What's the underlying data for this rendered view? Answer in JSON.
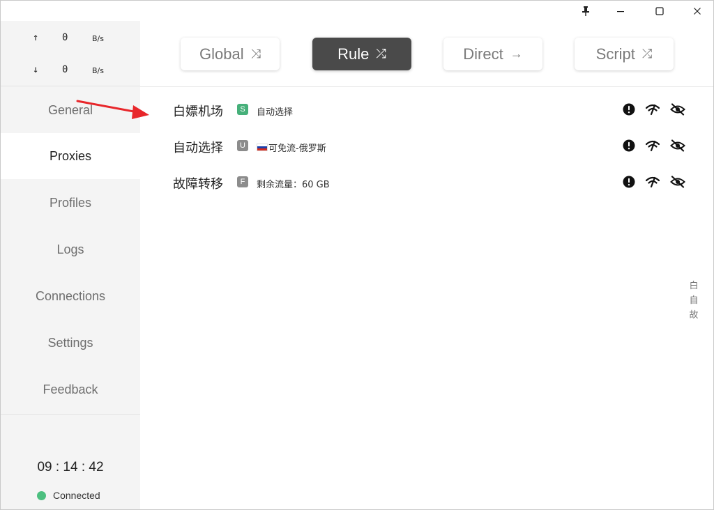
{
  "titlebar": {
    "pin_icon": "pin-icon",
    "minimize_icon": "minimize-icon",
    "maximize_icon": "maximize-icon",
    "close_icon": "close-icon"
  },
  "traffic": {
    "up_arrow": "↑",
    "up_value": "0",
    "up_unit": "B/s",
    "down_arrow": "↓",
    "down_value": "0",
    "down_unit": "B/s"
  },
  "nav": {
    "items": [
      {
        "label": "General"
      },
      {
        "label": "Proxies"
      },
      {
        "label": "Profiles"
      },
      {
        "label": "Logs"
      },
      {
        "label": "Connections"
      },
      {
        "label": "Settings"
      },
      {
        "label": "Feedback"
      }
    ],
    "active": "Proxies"
  },
  "status": {
    "clock": "09 : 14 : 42",
    "connection": "Connected",
    "connection_color": "#4cbf7f"
  },
  "modes": {
    "global_label": "Global",
    "global_glyph": "⤨",
    "rule_label": "Rule",
    "rule_glyph": "⤮",
    "direct_label": "Direct",
    "direct_glyph": "→",
    "script_label": "Script",
    "script_glyph": "⤮",
    "active": "Rule"
  },
  "groups": [
    {
      "name": "白嫖机场",
      "badge": "S",
      "badge_color": "#46b07a",
      "now": "自动选择"
    },
    {
      "name": "自动选择",
      "badge": "U",
      "badge_color": "#8c8c8c",
      "now": "可免流-俄罗斯",
      "flag": "russia-flag-icon"
    },
    {
      "name": "故障转移",
      "badge": "F",
      "badge_color": "#8c8c8c",
      "now": "剩余流量：60 GB"
    }
  ],
  "group_actions": {
    "info_icon": "exclamation-circle-icon",
    "latency_icon": "wifi-test-icon",
    "hide_icon": "eye-slash-icon"
  },
  "side_index": [
    "白",
    "自",
    "故"
  ],
  "annotation": {
    "color": "#e8262a"
  }
}
